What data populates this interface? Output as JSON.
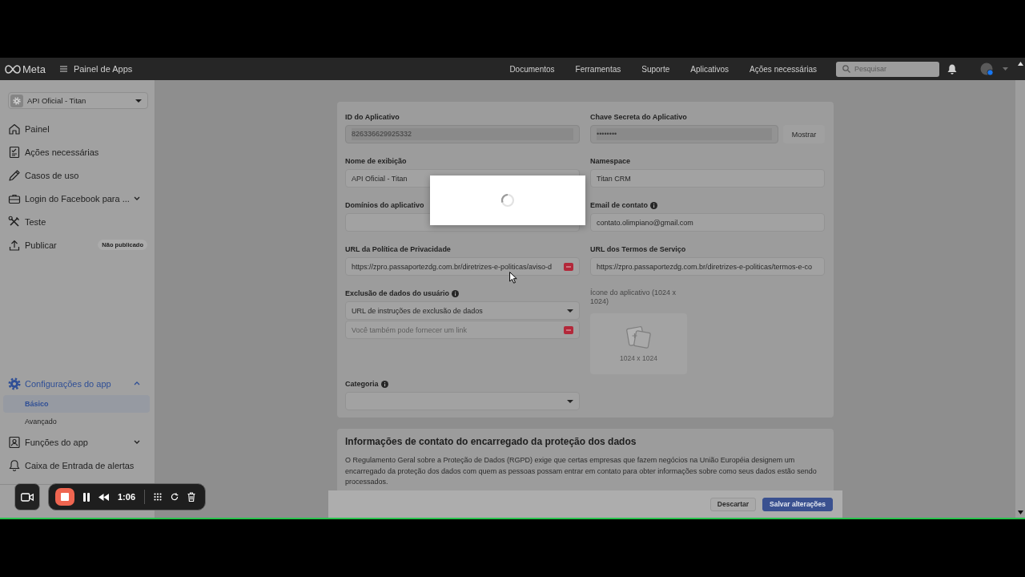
{
  "header": {
    "logo": "Meta",
    "title": "Painel de Apps",
    "links": [
      "Documentos",
      "Ferramentas",
      "Suporte",
      "Aplicativos",
      "Ações necessárias"
    ],
    "search": {
      "placeholder": "Pesquisar"
    }
  },
  "sidebar": {
    "app_selector": "API Oficial - Titan",
    "main_menu": [
      {
        "label": "Painel",
        "kind": "link",
        "selected": false
      },
      {
        "label": "Ações necessárias",
        "kind": "link",
        "selected": false
      },
      {
        "label": "Casos de uso",
        "kind": "link",
        "selected": false
      },
      {
        "label": "Login do Facebook para ...",
        "kind": "group",
        "expanded": false,
        "selected": false
      },
      {
        "label": "Teste",
        "kind": "link",
        "selected": false
      },
      {
        "label": "Publicar",
        "kind": "link",
        "badge": "Não publicado",
        "selected": false
      }
    ],
    "settings_menu": [
      {
        "label": "Configurações do app",
        "kind": "group",
        "expanded": true,
        "selected": true,
        "children": [
          {
            "label": "Básico",
            "selected": true
          },
          {
            "label": "Avançado",
            "selected": false
          }
        ]
      },
      {
        "label": "Funções do app",
        "kind": "group",
        "expanded": false,
        "selected": false
      },
      {
        "label": "Caixa de Entrada de alertas",
        "kind": "link",
        "selected": false
      }
    ]
  },
  "form": {
    "rows": [
      [
        {
          "label": "ID do Aplicativo",
          "kind": "text",
          "value": "826336629925332",
          "info": false,
          "disabled": true,
          "extension_icon": false
        },
        {
          "label": "Chave Secreta do Aplicativo",
          "kind": "secret",
          "value": "••••••••",
          "action": "Mostrar",
          "info": false,
          "disabled": true,
          "extension_icon": false
        }
      ],
      [
        {
          "label": "Nome de exibição",
          "kind": "text",
          "value": "API Oficial - Titan",
          "info": false,
          "disabled": false,
          "extension_icon": false
        },
        {
          "label": "Namespace",
          "kind": "text",
          "value": "Titan CRM",
          "info": false,
          "disabled": false,
          "extension_icon": false
        }
      ],
      [
        {
          "label": "Domínios do aplicativo",
          "kind": "text",
          "info": false,
          "disabled": false,
          "extension_icon": false
        },
        {
          "label": "Email de contato",
          "kind": "text",
          "value": "contato.olimpiano@gmail.com",
          "info": true,
          "disabled": false,
          "extension_icon": false
        }
      ],
      [
        {
          "label": "URL da Política de Privacidade",
          "kind": "text",
          "value": "https://zpro.passaportezdg.com.br/diretrizes-e-politicas/aviso-d",
          "info": false,
          "disabled": false,
          "extension_icon": true
        },
        {
          "label": "URL dos Termos de Serviço",
          "kind": "text",
          "value": "https://zpro.passaportezdg.com.br/diretrizes-e-politicas/termos-e-co",
          "info": false,
          "disabled": false,
          "extension_icon": false
        }
      ],
      [
        {
          "label": "Exclusão de dados do usuário",
          "kind": "select_with_link",
          "value": "URL de instruções de exclusão de dados",
          "placeholder": "Você também pode fornecer um link",
          "info": true,
          "disabled": false,
          "extension_icon": true
        },
        {
          "label": "Ícone do aplicativo (1024 x 1024)",
          "kind": "upload",
          "hint": "1024 x 1024",
          "info": false,
          "disabled": false
        }
      ],
      [
        {
          "label": "Categoria",
          "kind": "select",
          "info": true,
          "disabled": false,
          "extension_icon": false
        }
      ]
    ]
  },
  "data_protection": {
    "title": "Informações de contato do encarregado da proteção dos dados",
    "text": "O Regulamento Geral sobre a Proteção de Dados (RGPD) exige que certas empresas que fazem negócios na União Européia designem um encarregado da proteção dos dados com quem as pessoas possam entrar em contato para obter informações sobre como seus dados estão sendo processados."
  },
  "actions": [
    {
      "label": "Descartar",
      "kind": "secondary"
    },
    {
      "label": "Salvar alterações",
      "kind": "primary"
    }
  ],
  "dialog": {
    "loading": true
  },
  "recorder": {
    "time": "1:06"
  }
}
